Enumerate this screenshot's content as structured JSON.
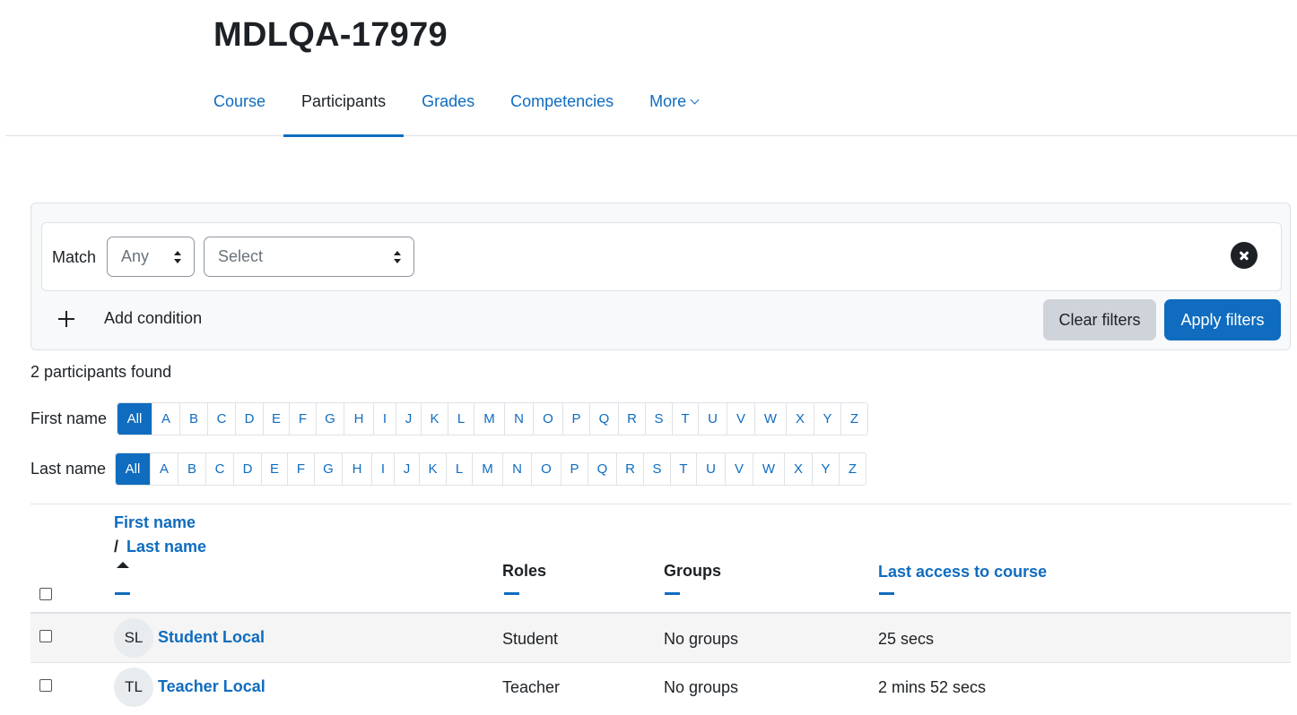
{
  "page": {
    "title": "MDLQA-17979"
  },
  "nav": {
    "tabs": [
      {
        "label": "Course"
      },
      {
        "label": "Participants"
      },
      {
        "label": "Grades"
      },
      {
        "label": "Competencies"
      },
      {
        "label": "More"
      }
    ],
    "active": "Participants"
  },
  "filters": {
    "match_label": "Match",
    "match_value": "Any",
    "type_value": "Select",
    "add_condition": "Add condition",
    "clear_filters": "Clear filters",
    "apply_filters": "Apply filters"
  },
  "summary": {
    "found": "2 participants found"
  },
  "initials": {
    "first_name_label": "First name",
    "last_name_label": "Last name",
    "letters": [
      "All",
      "A",
      "B",
      "C",
      "D",
      "E",
      "F",
      "G",
      "H",
      "I",
      "J",
      "K",
      "L",
      "M",
      "N",
      "O",
      "P",
      "Q",
      "R",
      "S",
      "T",
      "U",
      "V",
      "W",
      "X",
      "Y",
      "Z"
    ]
  },
  "table": {
    "headers": {
      "first_name": "First name",
      "slash": "/",
      "last_name": "Last name",
      "roles": "Roles",
      "groups": "Groups",
      "last_access": "Last access to course"
    },
    "rows": [
      {
        "initials": "SL",
        "name": "Student Local",
        "role": "Student",
        "groups": "No groups",
        "last_access": "25 secs"
      },
      {
        "initials": "TL",
        "name": "Teacher Local",
        "role": "Teacher",
        "groups": "No groups",
        "last_access": "2 mins 52 secs"
      }
    ]
  },
  "colors": {
    "primary": "#0f6cbf",
    "text": "#1d2125",
    "border": "#dee2e6",
    "secondary_btn": "#ced4da"
  },
  "icons": [
    "chevron-down-icon",
    "close-icon",
    "plus-icon",
    "sort-ascending-icon",
    "sort-dash-icon"
  ]
}
